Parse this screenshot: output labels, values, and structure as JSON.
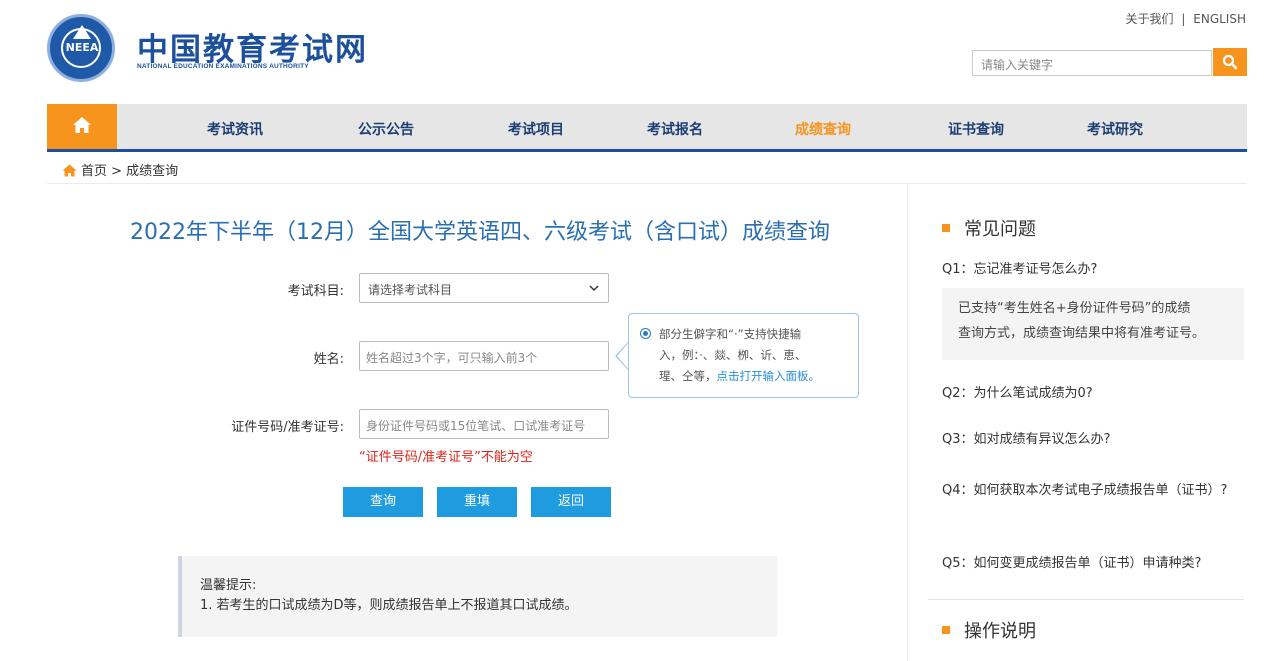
{
  "header": {
    "brand_cn": "中国教育考试网",
    "brand_en": "NATIONAL EDUCATION EXAMINATIONS AUTHORITY",
    "logo_text": "NEEA",
    "about_link": "关于我们",
    "separator": "|",
    "english_link": "ENGLISH",
    "search_placeholder": "请输入关键字"
  },
  "nav": {
    "items": [
      {
        "label": "考试资讯"
      },
      {
        "label": "公示公告"
      },
      {
        "label": "考试项目"
      },
      {
        "label": "考试报名"
      },
      {
        "label": "成绩查询"
      },
      {
        "label": "证书查询"
      },
      {
        "label": "考试研究"
      }
    ],
    "active": "成绩查询"
  },
  "breadcrumb": "首页 > 成绩查询",
  "main": {
    "title": "2022年下半年（12月）全国大学英语四、六级考试（含口试）成绩查询",
    "subject_label": "考试科目:",
    "subject_value": "请选择考试科目",
    "name_label": "姓名:",
    "name_placeholder": "姓名超过3个字，可只输入前3个",
    "id_label": "证件号码/准考证号:",
    "id_placeholder": "身份证件号码或15位笔试、口试准考证号",
    "tip_line1": "部分生僻字和“·”支持快捷输",
    "tip_line2": "入，例：·、燚、栁、䜣、恵、",
    "tip_line3_prefix": "瑆、仝等，",
    "tip_link": "点击打开输入面板。",
    "error": "“证件号码/准考证号”不能为空",
    "buttons": {
      "query": "查询",
      "reset": "重填",
      "back": "返回"
    },
    "notice_title": "温馨提示:",
    "notice_text": "1. 若考生的口试成绩为D等，则成绩报告单上不报道其口试成绩。"
  },
  "sidebar": {
    "faq_heading": "常见问题",
    "q1": "Q1：忘记准考证号怎么办?",
    "a1_line1": "已支持“考生姓名+身份证件号码”的成绩",
    "a1_line2": "查询方式，成绩查询结果中将有准考证号。",
    "q2": "Q2：为什么笔试成绩为0?",
    "q3": "Q3：如对成绩有异议怎么办?",
    "q4": "Q4：如何获取本次考试电子成绩报告单（证书）?",
    "q5": "Q5：如何变更成绩报告单（证书）申请种类?",
    "ops_heading": "操作说明"
  },
  "colors": {
    "accent": "#f7941d",
    "brand": "#1c4f9c",
    "button": "#1f9be0",
    "error": "#d9261c",
    "link": "#2a8fd8"
  }
}
